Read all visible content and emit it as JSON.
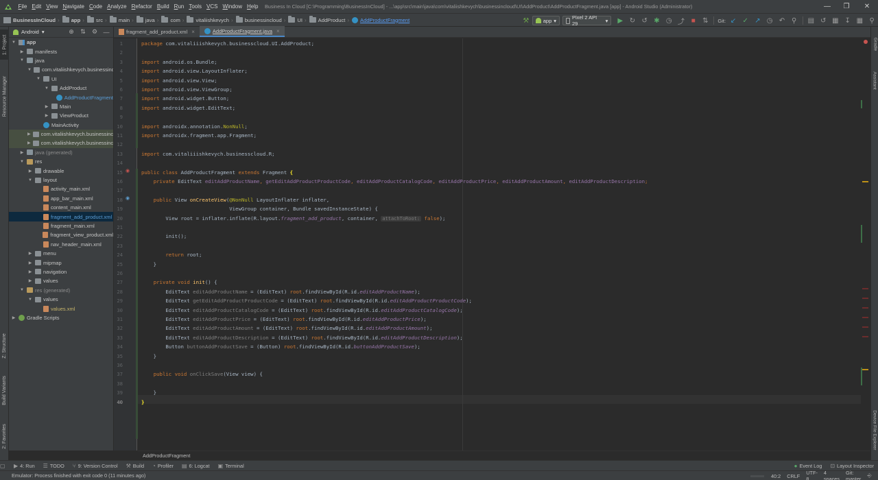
{
  "menubar": {
    "items": [
      "File",
      "Edit",
      "View",
      "Navigate",
      "Code",
      "Analyze",
      "Refactor",
      "Build",
      "Run",
      "Tools",
      "VCS",
      "Window",
      "Help"
    ],
    "window_title": "Business In Cloud [C:\\Programming\\BusinessInCloud] - ...\\app\\src\\main\\java\\com\\vitaliishkevych\\businessincloud\\UI\\AddProduct\\AddProductFragment.java [app] - Android Studio (Administrator)"
  },
  "navbar": {
    "breadcrumbs": [
      "BusinessInCloud",
      "app",
      "src",
      "main",
      "java",
      "com",
      "vitaliishkevych",
      "businessincloud",
      "UI",
      "AddProduct",
      "AddProductFragment"
    ],
    "run_config": "app",
    "device": "Pixel 2 API 29",
    "git_label": "Git:"
  },
  "left_strip": {
    "project": "1: Project",
    "resource_manager": "Resource Manager",
    "structure": "Z: Structure",
    "build_variants": "Build Variants",
    "favorites": "2: Favorites"
  },
  "right_strip": {
    "gradle": "Gradle",
    "assistant": "Assistant",
    "device_explorer": "Device File Explorer"
  },
  "project": {
    "view_mode": "Android",
    "tree": [
      {
        "label": "app",
        "depth": 0,
        "arrow": "down",
        "icon": "modfold",
        "style": "bold"
      },
      {
        "label": "manifests",
        "depth": 1,
        "arrow": "right",
        "icon": "fold"
      },
      {
        "label": "java",
        "depth": 1,
        "arrow": "down",
        "icon": "fold-src"
      },
      {
        "label": "com.vitaliishkevych.businessincloud",
        "depth": 2,
        "arrow": "down",
        "icon": "fold"
      },
      {
        "label": "UI",
        "depth": 3,
        "arrow": "down",
        "icon": "fold"
      },
      {
        "label": "AddProduct",
        "depth": 4,
        "arrow": "down",
        "icon": "fold"
      },
      {
        "label": "AddProductFragment",
        "depth": 5,
        "arrow": "",
        "icon": "cls",
        "style": "blue"
      },
      {
        "label": "Main",
        "depth": 4,
        "arrow": "right",
        "icon": "fold"
      },
      {
        "label": "ViewProduct",
        "depth": 4,
        "arrow": "right",
        "icon": "fold"
      },
      {
        "label": "MainActivity",
        "depth": 3,
        "arrow": "",
        "icon": "cls"
      },
      {
        "label": "com.vitaliishkevych.businessincloud (androidTest)",
        "depth": 2,
        "arrow": "right",
        "icon": "fold",
        "hl": true
      },
      {
        "label": "com.vitaliishkevych.businessincloud (test)",
        "depth": 2,
        "arrow": "right",
        "icon": "fold",
        "hl": true
      },
      {
        "label": "java (generated)",
        "depth": 1,
        "arrow": "right",
        "icon": "fold-src",
        "style": "gen"
      },
      {
        "label": "res",
        "depth": 1,
        "arrow": "down",
        "icon": "fold-res"
      },
      {
        "label": "drawable",
        "depth": 2,
        "arrow": "right",
        "icon": "fold"
      },
      {
        "label": "layout",
        "depth": 2,
        "arrow": "down",
        "icon": "fold"
      },
      {
        "label": "activity_main.xml",
        "depth": 3,
        "arrow": "",
        "icon": "xml"
      },
      {
        "label": "app_bar_main.xml",
        "depth": 3,
        "arrow": "",
        "icon": "xml"
      },
      {
        "label": "content_main.xml",
        "depth": 3,
        "arrow": "",
        "icon": "xml"
      },
      {
        "label": "fragment_add_product.xml",
        "depth": 3,
        "arrow": "",
        "icon": "xml",
        "sel": true,
        "style": "blue"
      },
      {
        "label": "fragment_main.xml",
        "depth": 3,
        "arrow": "",
        "icon": "xml"
      },
      {
        "label": "fragment_view_product.xml",
        "depth": 3,
        "arrow": "",
        "icon": "xml"
      },
      {
        "label": "nav_header_main.xml",
        "depth": 3,
        "arrow": "",
        "icon": "xml"
      },
      {
        "label": "menu",
        "depth": 2,
        "arrow": "right",
        "icon": "fold"
      },
      {
        "label": "mipmap",
        "depth": 2,
        "arrow": "right",
        "icon": "fold"
      },
      {
        "label": "navigation",
        "depth": 2,
        "arrow": "right",
        "icon": "fold"
      },
      {
        "label": "values",
        "depth": 2,
        "arrow": "right",
        "icon": "fold"
      },
      {
        "label": "res (generated)",
        "depth": 1,
        "arrow": "down",
        "icon": "fold-res",
        "style": "gen"
      },
      {
        "label": "values",
        "depth": 2,
        "arrow": "down",
        "icon": "fold"
      },
      {
        "label": "values.xml",
        "depth": 3,
        "arrow": "",
        "icon": "xml",
        "style": "yellow"
      },
      {
        "label": "Gradle Scripts",
        "depth": 0,
        "arrow": "right",
        "icon": "gradle"
      }
    ]
  },
  "tabs": [
    {
      "label": "fragment_add_product.xml",
      "type": "xml",
      "active": false
    },
    {
      "label": "AddProductFragment.java",
      "type": "class",
      "active": true
    }
  ],
  "editor": {
    "line_numbers": [
      "1",
      "2",
      "3",
      "4",
      "5",
      "6",
      "7",
      "8",
      "9",
      "10",
      "11",
      "12",
      "13",
      "14",
      "15",
      "16",
      "17",
      "18",
      "19",
      "20",
      "21",
      "22",
      "23",
      "24",
      "25",
      "26",
      "27",
      "28",
      "29",
      "30",
      "31",
      "32",
      "33",
      "34",
      "35",
      "36",
      "37",
      "38",
      "39",
      "40"
    ],
    "current_line": 40,
    "lines": [
      [
        [
          "kw",
          "package "
        ],
        [
          "",
          "com.vitaliiishkevych.businesscloud.UI.AddProduct;"
        ]
      ],
      [],
      [
        [
          "kw",
          "import "
        ],
        [
          "",
          "android.os.Bundle;"
        ]
      ],
      [
        [
          "kw",
          "import "
        ],
        [
          "",
          "android.view.LayoutInflater;"
        ]
      ],
      [
        [
          "kw",
          "import "
        ],
        [
          "",
          "android.view.View;"
        ]
      ],
      [
        [
          "kw",
          "import "
        ],
        [
          "",
          "android.view.ViewGroup;"
        ]
      ],
      [
        [
          "kw",
          "import "
        ],
        [
          "",
          "android.widget.Button;"
        ]
      ],
      [
        [
          "kw",
          "import "
        ],
        [
          "",
          "android.widget.EditText;"
        ]
      ],
      [],
      [
        [
          "kw",
          "import "
        ],
        [
          "",
          "androidx.annotation."
        ],
        [
          "an",
          "NonNull"
        ],
        [
          "",
          ";"
        ]
      ],
      [
        [
          "kw",
          "import "
        ],
        [
          "",
          "androidx.fragment.app.Fragment;"
        ]
      ],
      [],
      [
        [
          "kw",
          "import "
        ],
        [
          "",
          "com.vitaliiishkevych.businesscloud.R;"
        ]
      ],
      [],
      [
        [
          "kw",
          "public class "
        ],
        [
          "",
          "AddProductFragment "
        ],
        [
          "kw",
          "extends "
        ],
        [
          "",
          "Fragment "
        ],
        [
          "brace",
          "{"
        ]
      ],
      [
        [
          "",
          "    "
        ],
        [
          "kw",
          "private "
        ],
        [
          "",
          "EditText "
        ],
        [
          "fld",
          "editAddProductName"
        ],
        [
          "kw",
          ", "
        ],
        [
          "fld",
          "getEditAddProductProductCode"
        ],
        [
          "kw",
          ", "
        ],
        [
          "fld",
          "editAddProductCatalogCode"
        ],
        [
          "kw",
          ", "
        ],
        [
          "fld",
          "editAddProductPrice"
        ],
        [
          "kw",
          ", "
        ],
        [
          "fld",
          "editAddProductAmount"
        ],
        [
          "kw",
          ", "
        ],
        [
          "fld",
          "editAddProductDescription"
        ],
        [
          "kw",
          ";"
        ]
      ],
      [],
      [
        [
          "",
          "    "
        ],
        [
          "kw",
          "public "
        ],
        [
          "",
          "View "
        ],
        [
          "fn",
          "onCreateView"
        ],
        [
          "",
          "("
        ],
        [
          "an",
          "@NonNull "
        ],
        [
          "",
          "LayoutInflater inflater,"
        ]
      ],
      [
        [
          "",
          "                             ViewGroup container, Bundle savedInstanceState) {"
        ]
      ],
      [
        [
          "",
          "        View root = inflater.inflate(R.layout."
        ],
        [
          "fldi",
          "fragment_add_product"
        ],
        [
          "",
          ", container, "
        ],
        [
          "hint",
          "attachToRoot:"
        ],
        [
          "",
          ""
        ],
        [
          "kw",
          " false"
        ],
        [
          "",
          ");"
        ]
      ],
      [],
      [
        [
          "",
          "        init();"
        ]
      ],
      [],
      [
        [
          "",
          "        "
        ],
        [
          "kw",
          "return "
        ],
        [
          "",
          "root;"
        ]
      ],
      [
        [
          "",
          "    }"
        ]
      ],
      [],
      [
        [
          "",
          "    "
        ],
        [
          "kw",
          "private void "
        ],
        [
          "fn",
          "init"
        ],
        [
          "",
          "() {"
        ]
      ],
      [
        [
          "",
          "        EditText "
        ],
        [
          "unused",
          "editAddProductName"
        ],
        [
          "",
          " = (EditText) "
        ],
        [
          "kw",
          "root"
        ],
        [
          "",
          ".findViewById(R.id."
        ],
        [
          "fldi",
          "editAddProductName"
        ],
        [
          "",
          ");"
        ]
      ],
      [
        [
          "",
          "        EditText "
        ],
        [
          "unused",
          "getEditAddProductProductCode"
        ],
        [
          "",
          " = (EditText) "
        ],
        [
          "kw",
          "root"
        ],
        [
          "",
          ".findViewById(R.id."
        ],
        [
          "fldi",
          "editAddProductProductCode"
        ],
        [
          "",
          ");"
        ]
      ],
      [
        [
          "",
          "        EditText "
        ],
        [
          "unused",
          "editAddProductCatalogCode"
        ],
        [
          "",
          " = (EditText) "
        ],
        [
          "kw",
          "root"
        ],
        [
          "",
          ".findViewById(R.id."
        ],
        [
          "fldi",
          "editAddProductCatalogCode"
        ],
        [
          "",
          ");"
        ]
      ],
      [
        [
          "",
          "        EditText "
        ],
        [
          "unused",
          "editAddProductPrice"
        ],
        [
          "",
          " = (EditText) "
        ],
        [
          "kw",
          "root"
        ],
        [
          "",
          ".findViewById(R.id."
        ],
        [
          "fldi",
          "editAddProductPrice"
        ],
        [
          "",
          ");"
        ]
      ],
      [
        [
          "",
          "        EditText "
        ],
        [
          "unused",
          "editAddProductAmount"
        ],
        [
          "",
          " = (EditText) "
        ],
        [
          "kw",
          "root"
        ],
        [
          "",
          ".findViewById(R.id."
        ],
        [
          "fldi",
          "editAddProductAmount"
        ],
        [
          "",
          ");"
        ]
      ],
      [
        [
          "",
          "        EditText "
        ],
        [
          "unused",
          "editAddProductDescription"
        ],
        [
          "",
          " = (EditText) "
        ],
        [
          "kw",
          "root"
        ],
        [
          "",
          ".findViewById(R.id."
        ],
        [
          "fldi",
          "editAddProductDescription"
        ],
        [
          "",
          ");"
        ]
      ],
      [
        [
          "",
          "        Button "
        ],
        [
          "unused",
          "buttonAddProductSave"
        ],
        [
          "",
          " = (Button) "
        ],
        [
          "kw",
          "root"
        ],
        [
          "",
          ".findViewById(R.id."
        ],
        [
          "fldi",
          "buttonAddProductSave"
        ],
        [
          "",
          ");"
        ]
      ],
      [
        [
          "",
          "    }"
        ]
      ],
      [],
      [
        [
          "",
          "    "
        ],
        [
          "kw",
          "public void "
        ],
        [
          "unused",
          "onClickSave"
        ],
        [
          "",
          "(View view) {"
        ]
      ],
      [],
      [
        [
          "",
          "    }"
        ]
      ],
      [
        [
          "brace",
          "}"
        ]
      ]
    ]
  },
  "breadcrumb_bottom": "AddProductFragment",
  "bottom_tools": [
    {
      "icon": "run-icon",
      "glyph": "▶",
      "label": "4: Run"
    },
    {
      "icon": "todo-icon",
      "glyph": "☰",
      "label": "TODO"
    },
    {
      "icon": "vcs-icon",
      "glyph": "⑂",
      "label": "9: Version Control"
    },
    {
      "icon": "build-icon",
      "glyph": "⚒",
      "label": "Build"
    },
    {
      "icon": "profiler-icon",
      "glyph": "◔",
      "label": "Profiler"
    },
    {
      "icon": "logcat-icon",
      "glyph": "▤",
      "label": "6: Logcat"
    },
    {
      "icon": "terminal-icon",
      "glyph": "▣",
      "label": "Terminal"
    }
  ],
  "right_tools": [
    {
      "icon": "event-log-icon",
      "glyph": "●",
      "label": "Event Log"
    },
    {
      "icon": "layout-inspector-icon",
      "glyph": "⊡",
      "label": "Layout Inspector"
    }
  ],
  "status": {
    "message": "Emulator: Process finished with exit code 0 (11 minutes ago)",
    "position": "40:2",
    "line_sep": "CRLF",
    "encoding": "UTF-8",
    "indent": "4 spaces",
    "git_branch": "Git: master"
  },
  "colors": {
    "keyword": "#cc7832",
    "annotation": "#bbb529",
    "method": "#ffc66d",
    "field": "#9876aa",
    "default_text": "#a9b7c6",
    "background": "#2b2b2b",
    "panel": "#3c3f41"
  }
}
